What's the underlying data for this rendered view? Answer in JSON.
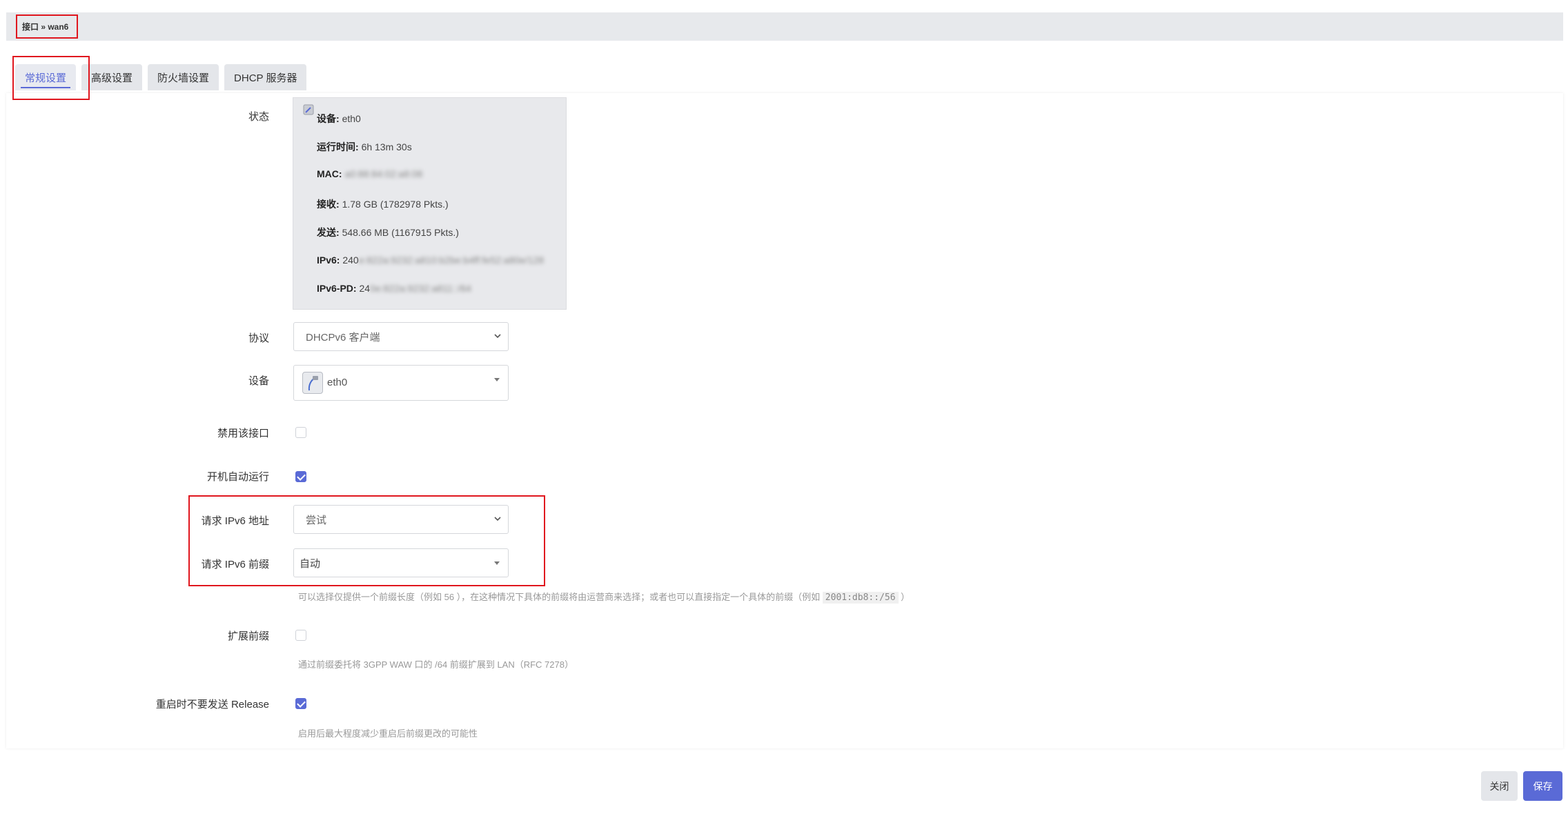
{
  "breadcrumb": "接口 » wan6",
  "tabs": [
    "常规设置",
    "高级设置",
    "防火墙设置",
    "DHCP 服务器"
  ],
  "status": {
    "label": "状态",
    "device_key": "设备:",
    "device_val": "eth0",
    "uptime_key": "运行时间:",
    "uptime_val": "6h 13m 30s",
    "mac_key": "MAC:",
    "mac_val": "a0:88:84:02:a8:08",
    "rx_key": "接收:",
    "rx_val": "1.78 GB (1782978 Pkts.)",
    "tx_key": "发送:",
    "tx_val": "548.66 MB (1167915 Pkts.)",
    "ipv6_key": "IPv6:",
    "ipv6_visible": "240",
    "ipv6_blur": "e:822a:9232:a810:b2be:b4ff:fe52:a80e/128",
    "ipv6pd_key": "IPv6-PD:",
    "ipv6pd_visible": "24",
    "ipv6pd_blur": "0e:822a:9232:a811::/64"
  },
  "fields": {
    "protocol_label": "协议",
    "protocol_value": "DHCPv6 客户端",
    "device_label": "设备",
    "device_value": "eth0",
    "disable_label": "禁用该接口",
    "autostart_label": "开机自动运行",
    "req_addr_label": "请求 IPv6 地址",
    "req_addr_value": "尝试",
    "req_prefix_label": "请求 IPv6 前缀",
    "req_prefix_value": "自动",
    "prefix_hint_a": "可以选择仅提供一个前缀长度（例如 56 ），在这种情况下具体的前缀将由运营商来选择；或者也可以直接指定一个具体的前缀（例如 ",
    "prefix_hint_code": "2001:db8::/56",
    "prefix_hint_b": " ）",
    "extend_label": "扩展前缀",
    "extend_hint": "通过前缀委托将 3GPP WAW 口的 /64 前缀扩展到 LAN（RFC 7278）",
    "norelease_label": "重启时不要发送 Release",
    "norelease_hint": "启用后最大程度减少重启后前缀更改的可能性"
  },
  "states": {
    "disable": false,
    "autostart": true,
    "extend": false,
    "norelease": true
  },
  "buttons": {
    "close": "关闭",
    "save": "保存"
  },
  "colors": {
    "accent": "#5a6ad6",
    "highlight": "#e0161e"
  }
}
